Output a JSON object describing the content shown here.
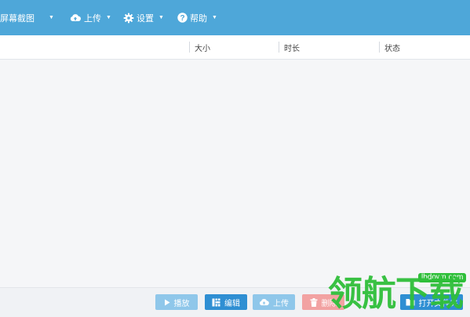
{
  "toolbar": {
    "screenshot_label": "屏幕截图",
    "upload_label": "上传",
    "settings_label": "设置",
    "help_label": "帮助"
  },
  "columns": {
    "size": "大小",
    "duration": "时长",
    "status": "状态"
  },
  "actions": {
    "play_label": "播放",
    "edit_label": "编辑",
    "upload_label": "上传",
    "delete_label": "删除",
    "open_folder_label": "打开文件夹"
  },
  "watermark": {
    "text": "领航下载",
    "domain": "lhdown.com"
  },
  "colors": {
    "topbar": "#4ea7d9",
    "play_button": "#8fc7ea",
    "edit_button": "#2f8fd3",
    "upload_button": "#8fc7ea",
    "delete_button": "#f2a2a2",
    "open_folder_button": "#2f8fd3",
    "watermark_green": "#2fbf3a"
  },
  "icons": {
    "upload": "cloud-upload-icon",
    "settings": "gear-icon",
    "help": "question-circle-icon",
    "dropdown": "caret-down-icon",
    "play": "play-icon",
    "edit": "edit-icon",
    "delete": "trash-icon",
    "folder": "folder-icon"
  }
}
